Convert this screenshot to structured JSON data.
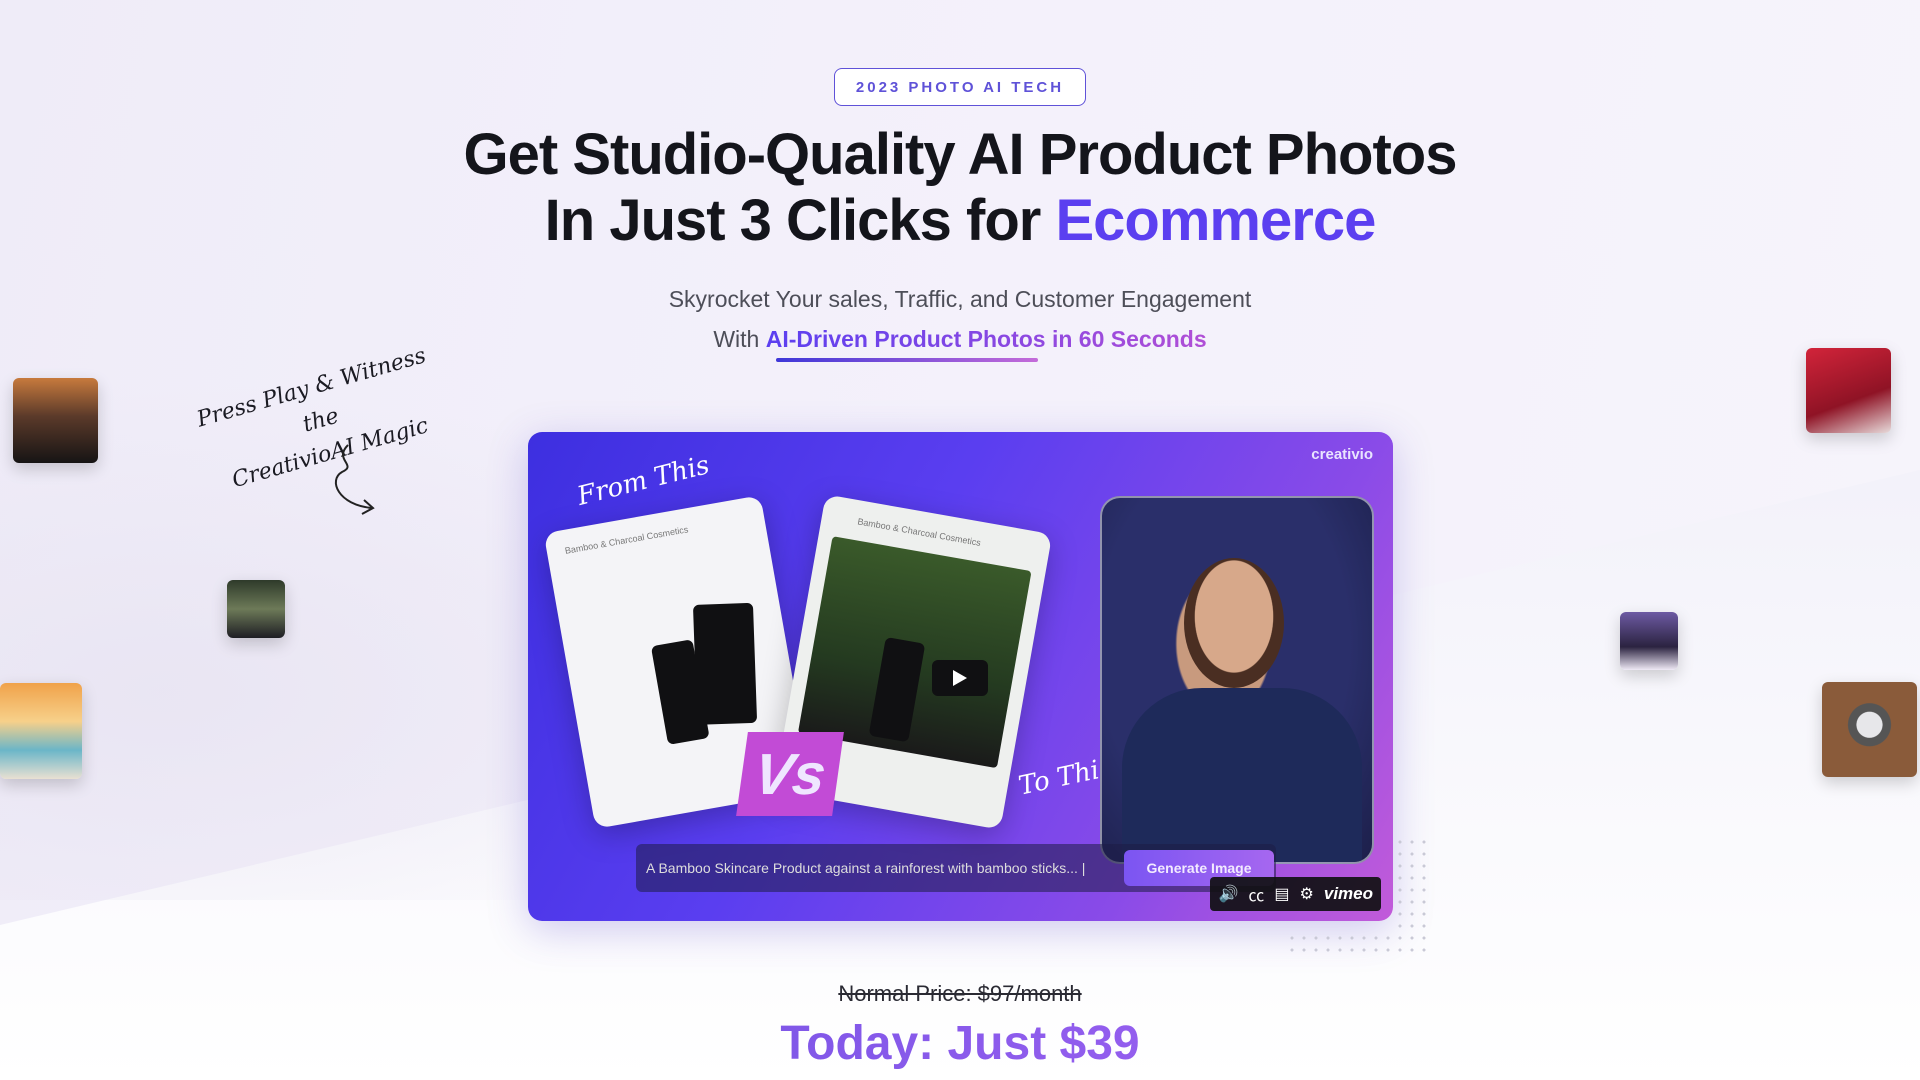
{
  "hero": {
    "badge": "2023 PHOTO AI TECH",
    "headline_line1": "Get Studio-Quality AI Product Photos",
    "headline_line2_prefix": "In Just 3 Clicks for ",
    "headline_accent": "Ecommerce",
    "subtitle_line1": "Skyrocket Your sales, Traffic, and Customer Engagement",
    "subtitle_line2_prefix": "With ",
    "subtitle_line2_highlight": "AI-Driven Product Photos in 60 Seconds"
  },
  "side_note": {
    "line1": "Press Play & Witness the",
    "line2": "CreativioAI Magic"
  },
  "video": {
    "brand": "creativio",
    "from_label": "From This",
    "to_label": "To This",
    "vs_label": "Vs",
    "card_a_caption": "Bamboo & Charcoal Cosmetics",
    "card_b_caption": "Bamboo & Charcoal Cosmetics",
    "prompt_text": "A Bamboo Skincare Product against a rainforest with bamboo sticks... |",
    "generate_label": "Generate Image",
    "controls": {
      "volume_icon": "volume-icon",
      "cc_icon": "captions-icon",
      "transcript_icon": "transcript-icon",
      "settings_icon": "gear-icon",
      "brand": "vimeo"
    }
  },
  "pricing": {
    "normal_price": "Normal Price: $97/month",
    "today_price": "Today: Just $39"
  },
  "colors": {
    "accent": "#5b3ff0",
    "badge": "#5f52d8",
    "price": "#8a5bea"
  }
}
